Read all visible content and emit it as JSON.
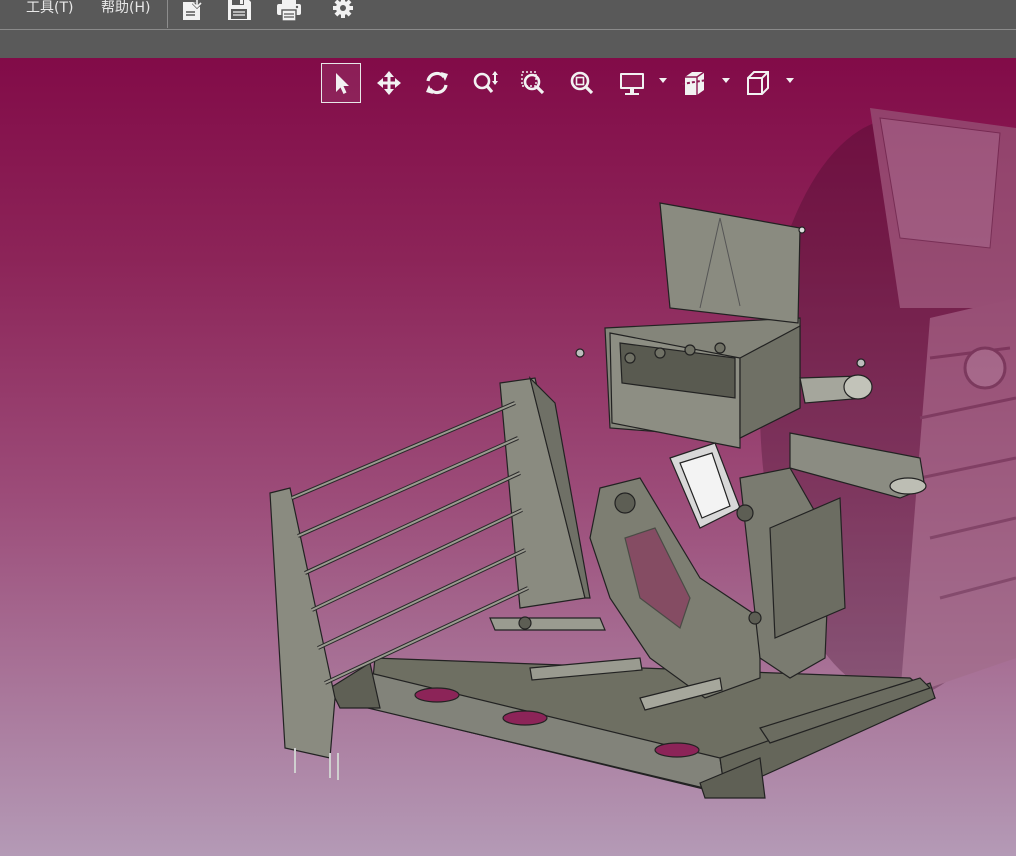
{
  "menu": {
    "tools_label": "工具(T)",
    "help_label": "帮助(H)"
  },
  "toolbar": {
    "icons": [
      "import-icon",
      "save-icon",
      "print-icon",
      "gear-icon"
    ]
  },
  "view_toolbar": {
    "active_tool": "select",
    "tools": [
      "select",
      "pan",
      "rotate",
      "zoom",
      "zoom-box",
      "zoom-fit",
      "display-mode",
      "section",
      "view-cube"
    ]
  },
  "colors": {
    "menubar_bg": "#595959",
    "viewport_top": "#820b48",
    "viewport_bottom": "#b49ab6",
    "model_fill": "#77786a",
    "model_stroke": "#222222"
  }
}
